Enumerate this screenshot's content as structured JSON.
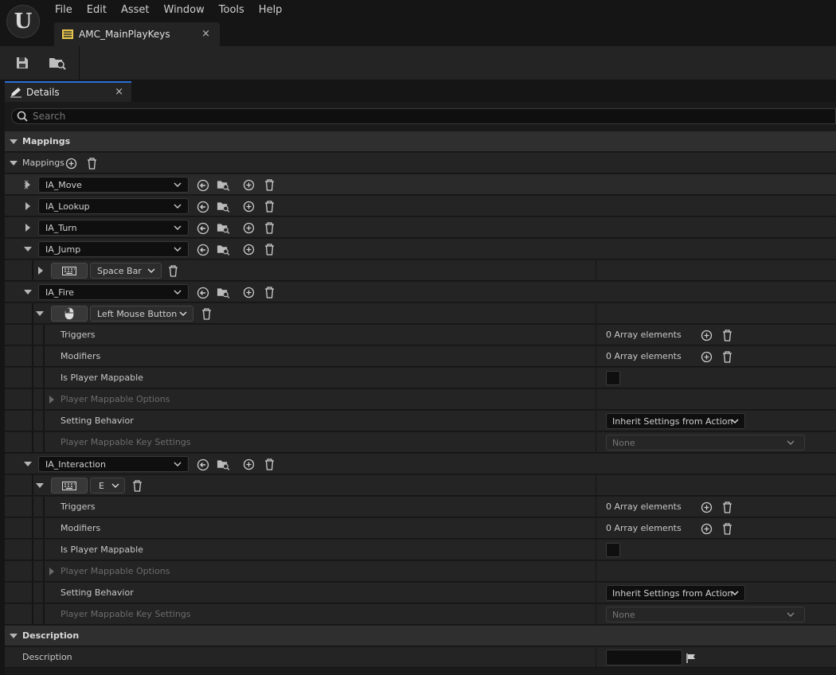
{
  "menu": [
    "File",
    "Edit",
    "Asset",
    "Window",
    "Tools",
    "Help"
  ],
  "doc_tab": {
    "title": "AMC_MainPlayKeys",
    "close": "×"
  },
  "details_tab": {
    "title": "Details",
    "close": "×"
  },
  "search": {
    "placeholder": "Search"
  },
  "sections": {
    "mappings_cat": "Mappings",
    "mappings_prop": "Mappings",
    "description_cat": "Description",
    "description_prop": "Description"
  },
  "actions": [
    {
      "name": "IA_Move"
    },
    {
      "name": "IA_Lookup"
    },
    {
      "name": "IA_Turn"
    },
    {
      "name": "IA_Jump",
      "key": "Space Bar"
    },
    {
      "name": "IA_Fire",
      "key": "Left Mouse Button"
    },
    {
      "name": "IA_Interaction",
      "key": "E"
    }
  ],
  "props": {
    "triggers": "Triggers",
    "modifiers": "Modifiers",
    "is_player_mappable": "Is Player Mappable",
    "player_mappable_options": "Player Mappable Options",
    "setting_behavior": "Setting Behavior",
    "player_mappable_key_settings": "Player Mappable Key Settings"
  },
  "values": {
    "array": "0 Array elements",
    "setting_behavior": "Inherit Settings from Action",
    "key_settings": "None"
  },
  "colors": {
    "accent": "#2a6fd6",
    "row": "#242424",
    "input": "#0f0f0f"
  }
}
